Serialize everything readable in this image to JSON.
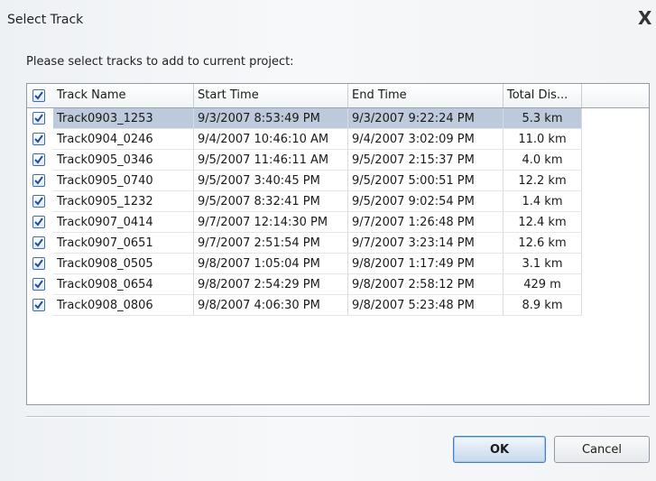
{
  "dialog": {
    "title": "Select Track",
    "close_label": "X",
    "prompt": "Please select tracks to add to current project:",
    "ok_label": "OK",
    "cancel_label": "Cancel"
  },
  "table": {
    "header_checked": true,
    "columns": [
      "Track Name",
      "Start Time",
      "End Time",
      "Total Dis..."
    ],
    "rows": [
      {
        "checked": true,
        "name": "Track0903_1253",
        "start": "9/3/2007 8:53:49 PM",
        "end": "9/3/2007 9:22:24 PM",
        "distance": "5.3 km",
        "selected": true
      },
      {
        "checked": true,
        "name": "Track0904_0246",
        "start": "9/4/2007 10:46:10 AM",
        "end": "9/4/2007 3:02:09 PM",
        "distance": "11.0 km"
      },
      {
        "checked": true,
        "name": "Track0905_0346",
        "start": "9/5/2007 11:46:11 AM",
        "end": "9/5/2007 2:15:37 PM",
        "distance": "4.0 km"
      },
      {
        "checked": true,
        "name": "Track0905_0740",
        "start": "9/5/2007 3:40:45 PM",
        "end": "9/5/2007 5:00:51 PM",
        "distance": "12.2 km"
      },
      {
        "checked": true,
        "name": "Track0905_1232",
        "start": "9/5/2007 8:32:41 PM",
        "end": "9/5/2007 9:02:54 PM",
        "distance": "1.4 km"
      },
      {
        "checked": true,
        "name": "Track0907_0414",
        "start": "9/7/2007 12:14:30 PM",
        "end": "9/7/2007 1:26:48 PM",
        "distance": "12.4 km"
      },
      {
        "checked": true,
        "name": "Track0907_0651",
        "start": "9/7/2007 2:51:54 PM",
        "end": "9/7/2007 3:23:14 PM",
        "distance": "12.6 km"
      },
      {
        "checked": true,
        "name": "Track0908_0505",
        "start": "9/8/2007 1:05:04 PM",
        "end": "9/8/2007 1:17:49 PM",
        "distance": "3.1 km"
      },
      {
        "checked": true,
        "name": "Track0908_0654",
        "start": "9/8/2007 2:54:29 PM",
        "end": "9/8/2007 2:58:12 PM",
        "distance": "429 m"
      },
      {
        "checked": true,
        "name": "Track0908_0806",
        "start": "9/8/2007 4:06:30 PM",
        "end": "9/8/2007 5:23:48 PM",
        "distance": "8.9 km"
      }
    ]
  },
  "colors": {
    "selection": "#bccadb",
    "checkbox_border": "#3a6fb5",
    "checkmark": "#1f4f9a"
  }
}
